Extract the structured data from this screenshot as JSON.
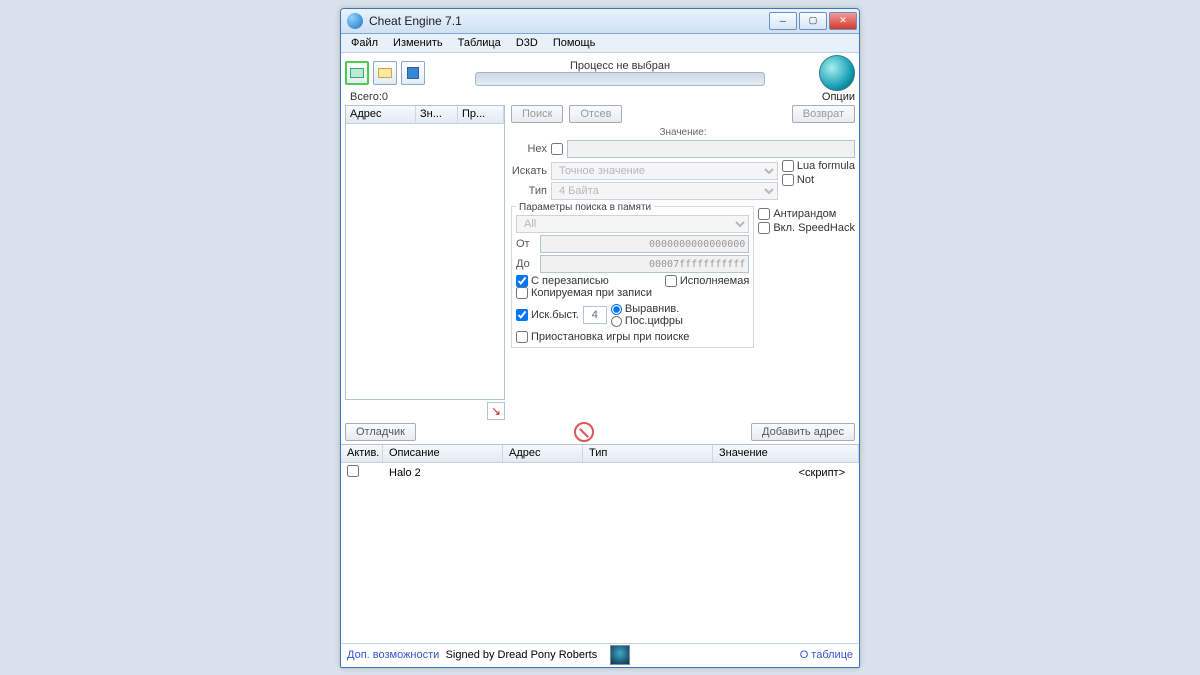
{
  "window": {
    "title": "Cheat Engine 7.1"
  },
  "menu": {
    "file": "Файл",
    "edit": "Изменить",
    "table": "Таблица",
    "d3d": "D3D",
    "help": "Помощь"
  },
  "toolbar": {
    "process_status": "Процесс не выбран",
    "options": "Опции"
  },
  "total": {
    "prefix": "Всего:",
    "value": "0"
  },
  "resultcols": {
    "addr": "Адрес",
    "val": "Зн...",
    "prev": "Пр..."
  },
  "scan": {
    "search_btn": "Поиск",
    "filter_btn": "Отсев",
    "revert_btn": "Возврат",
    "value_label": "Значение:",
    "hex_label": "Hex",
    "hex_value": "",
    "search_type_label": "Искать",
    "search_type": "Точное значение",
    "value_type_label": "Тип",
    "value_type": "4 Байта",
    "lua_formula": "Lua formula",
    "not": "Not",
    "mem_group": "Параметры поиска в памяти",
    "mem_region": "All",
    "from_label": "От",
    "from_value": "0000000000000000",
    "to_label": "До",
    "to_value": "00007fffffffffff",
    "overwrite": "С перезаписью",
    "copyonwrite": "Копируемая при записи",
    "executable": "Исполняемая",
    "antirandom": "Антирандом",
    "speedhack": "Вкл. SpeedHack",
    "fastscan": "Иск.быст.",
    "fastscan_value": "4",
    "alignment": "Выравнив.",
    "lastdigits": "Пос.цифры",
    "pause": "Приостановка игры при поиске"
  },
  "ctrlbar": {
    "debugger": "Отладчик",
    "add_address": "Добавить адрес"
  },
  "gridcols": {
    "active": "Актив.",
    "desc": "Описание",
    "addr": "Адрес",
    "type": "Тип",
    "value": "Значение"
  },
  "rows": [
    {
      "desc": "Halo 2",
      "value": "<скрипт>"
    }
  ],
  "bottom": {
    "extras": "Доп. возможности",
    "signed": "Signed by Dread Pony Roberts",
    "about": "О таблице"
  }
}
